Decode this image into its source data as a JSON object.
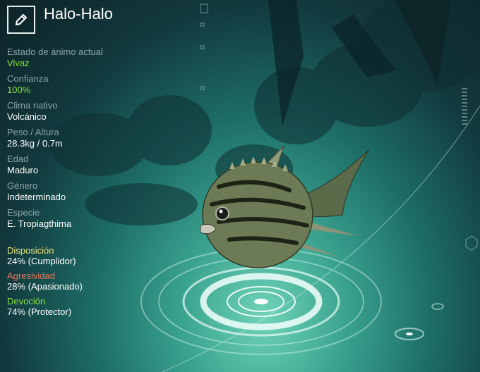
{
  "creature": {
    "name": "Halo-Halo",
    "edit_icon": "pencil-icon"
  },
  "stats": [
    {
      "label": "Estado de ánimo actual",
      "value": "Vivaz",
      "highlight": true
    },
    {
      "label": "Confianza",
      "value": "100%",
      "highlight": true
    },
    {
      "label": "Clima nativo",
      "value": "Volcánico",
      "highlight": false
    },
    {
      "label": "Peso / Altura",
      "value": "28.3kg / 0.7m",
      "highlight": false
    },
    {
      "label": "Edad",
      "value": "Maduro",
      "highlight": false
    },
    {
      "label": "Género",
      "value": "Indeterminado",
      "highlight": false
    },
    {
      "label": "Especie",
      "value": "E. Tropiagthima",
      "highlight": false
    }
  ],
  "traits": [
    {
      "label": "Disposición",
      "value": "24% (Cumplidor)",
      "color": "#e9e37a"
    },
    {
      "label": "Agresividad",
      "value": "28% (Apasionado)",
      "color": "#e8735a"
    },
    {
      "label": "Devoción",
      "value": "74% (Protector)",
      "color": "#86e23f"
    }
  ],
  "colors": {
    "highlight": "#86e23f",
    "label": "#8aa4a8",
    "background": "#1d6d67"
  }
}
